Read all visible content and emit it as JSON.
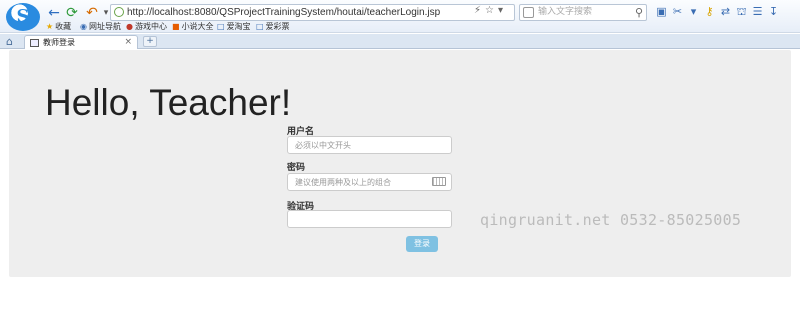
{
  "browser": {
    "url": "http://localhost:8080/QSProjectTrainingSystem/houtai/teacherLogin.jsp",
    "search_placeholder": "输入文字搜索",
    "bookmarks": [
      "收藏",
      "网址导航",
      "游戏中心",
      "小说大全",
      "爱淘宝",
      "爱彩票"
    ],
    "tab_title": "教师登录",
    "tab_close": "×",
    "new_tab": "+"
  },
  "page": {
    "heading": "Hello, Teacher!",
    "username_label": "用户名",
    "username_placeholder": "必须以中文开头",
    "password_label": "密码",
    "password_placeholder": "建议使用两种及以上的组合",
    "code_label": "验证码",
    "code_value": "",
    "login_button": "登录"
  },
  "watermark": "qingruanit.net 0532-85025005",
  "colors": {
    "jumbotron_bg": "#eeeeee",
    "button_bg": "#7fc1e2",
    "toolbar_bg": "#e7eef8"
  },
  "icons": [
    "browser-logo-icon",
    "back-arrow-icon",
    "refresh-icon",
    "undo-icon",
    "lock-icon",
    "star-icon",
    "search-icon",
    "home-icon",
    "keyboard-icon",
    "page-icon"
  ]
}
